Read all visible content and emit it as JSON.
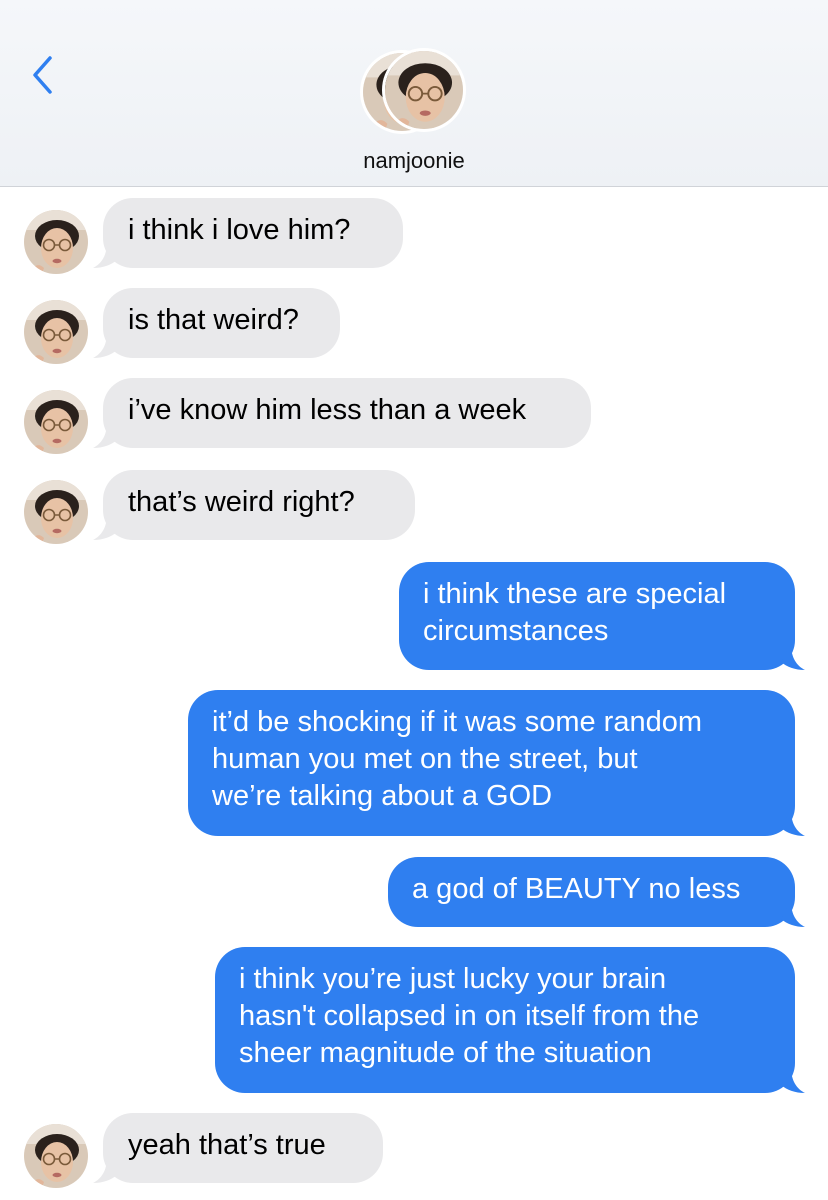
{
  "header": {
    "contact_name": "namjoonie",
    "back_icon": "chevron-left-icon"
  },
  "colors": {
    "accent": "#2f7ff0",
    "incoming_bubble": "#e9e9eb",
    "outgoing_text": "#ffffff"
  },
  "messages": [
    {
      "direction": "incoming",
      "text": "i think i love him?"
    },
    {
      "direction": "incoming",
      "text": "is that weird?"
    },
    {
      "direction": "incoming",
      "text": "i’ve know him less than a week"
    },
    {
      "direction": "incoming",
      "text": "that’s weird right?"
    },
    {
      "direction": "outgoing",
      "text": "i think these are special\ncircumstances"
    },
    {
      "direction": "outgoing",
      "text": "it’d be shocking if it was some random\nhuman you met on the street, but\nwe’re talking about a GOD"
    },
    {
      "direction": "outgoing",
      "text": "a god of BEAUTY no less"
    },
    {
      "direction": "outgoing",
      "text": "i think you’re just lucky your brain\nhasn't collapsed in on itself from the\nsheer magnitude of the situation"
    },
    {
      "direction": "incoming",
      "text": "yeah that’s true"
    }
  ]
}
